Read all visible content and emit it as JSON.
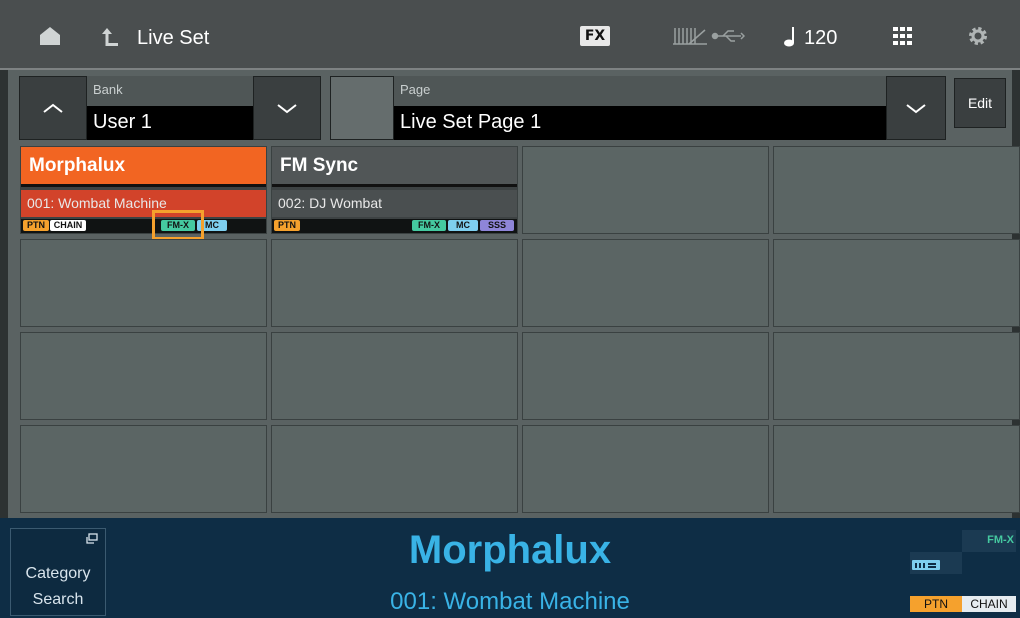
{
  "header": {
    "breadcrumb": "Live Set",
    "fx_label": "FX",
    "tempo": "120"
  },
  "bank": {
    "label": "Bank",
    "value": "User 1"
  },
  "page": {
    "label": "Page",
    "value": "Live Set Page 1"
  },
  "edit_label": "Edit",
  "slots": [
    {
      "name": "Morphalux",
      "sub": "001: Wombat Machine",
      "tags": [
        "PTN",
        "CHAIN",
        "FM-X",
        "MC"
      ]
    },
    {
      "name": "FM Sync",
      "sub": "002: DJ Wombat",
      "tags": [
        "PTN",
        "FM-X",
        "MC",
        "SSS"
      ]
    }
  ],
  "footer": {
    "category_line1": "Category",
    "category_line2": "Search",
    "selected_name": "Morphalux",
    "selected_sub": "001: Wombat Machine",
    "tag_fmx": "FM-X",
    "tag_ptn": "PTN",
    "tag_chain": "CHAIN"
  },
  "colors": {
    "accent_orange": "#f26522",
    "selected_sub": "#d2432a",
    "name_blue": "#39b3e6",
    "tag_ptn": "#f5a12d",
    "tag_fmx": "#45c9a0",
    "tag_mc": "#7ecfef",
    "tag_sss": "#8e85d8",
    "highlight_box": "#f5a12d"
  }
}
